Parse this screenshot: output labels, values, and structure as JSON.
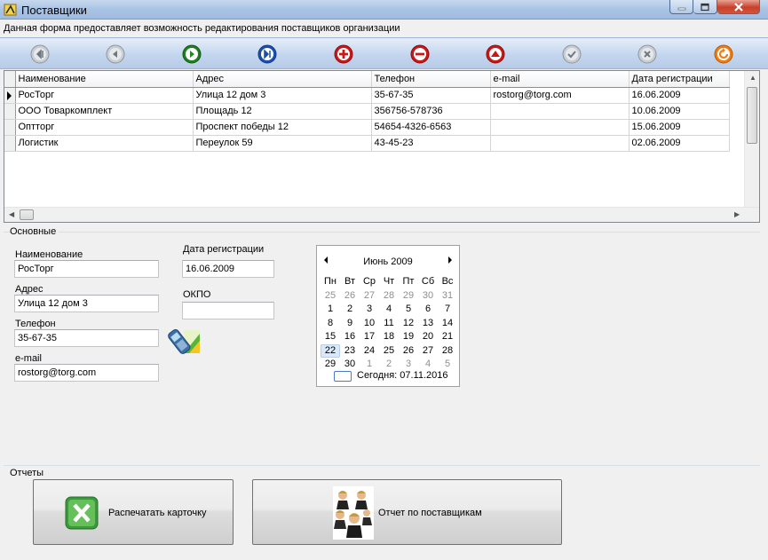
{
  "window": {
    "title": "Поставщики"
  },
  "description": "Данная форма предоставляет  возможность редактирования поставщиков организации",
  "toolbar": {
    "buttons": [
      {
        "name": "first",
        "color": "#9aa3ad"
      },
      {
        "name": "prev",
        "color": "#9aa3ad"
      },
      {
        "name": "next",
        "color": "#2e9b2e"
      },
      {
        "name": "last",
        "color": "#1f5fc2"
      },
      {
        "name": "add",
        "color": "#d22020"
      },
      {
        "name": "delete",
        "color": "#d22020"
      },
      {
        "name": "up",
        "color": "#d22020"
      },
      {
        "name": "post",
        "color": "#9aa3ad"
      },
      {
        "name": "cancel",
        "color": "#9aa3ad"
      },
      {
        "name": "refresh",
        "color": "#f07d14"
      }
    ]
  },
  "grid": {
    "columns": [
      "Наименование",
      "Адрес",
      "Телефон",
      "e-mail",
      "Дата регистрации"
    ],
    "rows": [
      [
        "РосТорг",
        "Улица 12 дом 3",
        "35-67-35",
        "rostorg@torg.com",
        "16.06.2009"
      ],
      [
        "ООО Товаркомплект",
        "Площадь 12",
        "356756-578736",
        "",
        "10.06.2009"
      ],
      [
        "Оптторг",
        "Проспект победы 12",
        "54654-4326-6563",
        "",
        "15.06.2009"
      ],
      [
        "Логистик",
        "Переулок 59",
        "43-45-23",
        "",
        "02.06.2009"
      ]
    ],
    "current_row": 0
  },
  "basic": {
    "group_label": "Основные",
    "name_label": "Наименование",
    "name_value": "РосТорг",
    "address_label": "Адрес",
    "address_value": "Улица 12 дом 3",
    "phone_label": "Телефон",
    "phone_value": "35-67-35",
    "email_label": "e-mail",
    "email_value": "rostorg@torg.com",
    "regdate_label": "Дата регистрации",
    "regdate_value": "16.06.2009",
    "okpo_label": "ОКПО",
    "okpo_value": ""
  },
  "calendar": {
    "month_title": "Июнь 2009",
    "weekdays": [
      "Пн",
      "Вт",
      "Ср",
      "Чт",
      "Пт",
      "Сб",
      "Вс"
    ],
    "weeks": [
      [
        [
          "25",
          true
        ],
        [
          "26",
          true
        ],
        [
          "27",
          true
        ],
        [
          "28",
          true
        ],
        [
          "29",
          true
        ],
        [
          "30",
          true
        ],
        [
          "31",
          true
        ]
      ],
      [
        [
          "1",
          false
        ],
        [
          "2",
          false
        ],
        [
          "3",
          false
        ],
        [
          "4",
          false
        ],
        [
          "5",
          false
        ],
        [
          "6",
          false
        ],
        [
          "7",
          false
        ]
      ],
      [
        [
          "8",
          false
        ],
        [
          "9",
          false
        ],
        [
          "10",
          false
        ],
        [
          "11",
          false
        ],
        [
          "12",
          false
        ],
        [
          "13",
          false
        ],
        [
          "14",
          false
        ]
      ],
      [
        [
          "15",
          false
        ],
        [
          "16",
          false
        ],
        [
          "17",
          false
        ],
        [
          "18",
          false
        ],
        [
          "19",
          false
        ],
        [
          "20",
          false
        ],
        [
          "21",
          false
        ]
      ],
      [
        [
          "22",
          false
        ],
        [
          "23",
          false
        ],
        [
          "24",
          false
        ],
        [
          "25",
          false
        ],
        [
          "26",
          false
        ],
        [
          "27",
          false
        ],
        [
          "28",
          false
        ]
      ],
      [
        [
          "29",
          false
        ],
        [
          "30",
          false
        ],
        [
          "1",
          true
        ],
        [
          "2",
          true
        ],
        [
          "3",
          true
        ],
        [
          "4",
          true
        ],
        [
          "5",
          true
        ]
      ]
    ],
    "selected_day": "22",
    "today_text": "Сегодня: 07.11.2016"
  },
  "reports": {
    "group_label": "Отчеты",
    "print_card_label": "Распечатать карточку",
    "suppliers_report_label": "Отчет по поставщикам"
  }
}
